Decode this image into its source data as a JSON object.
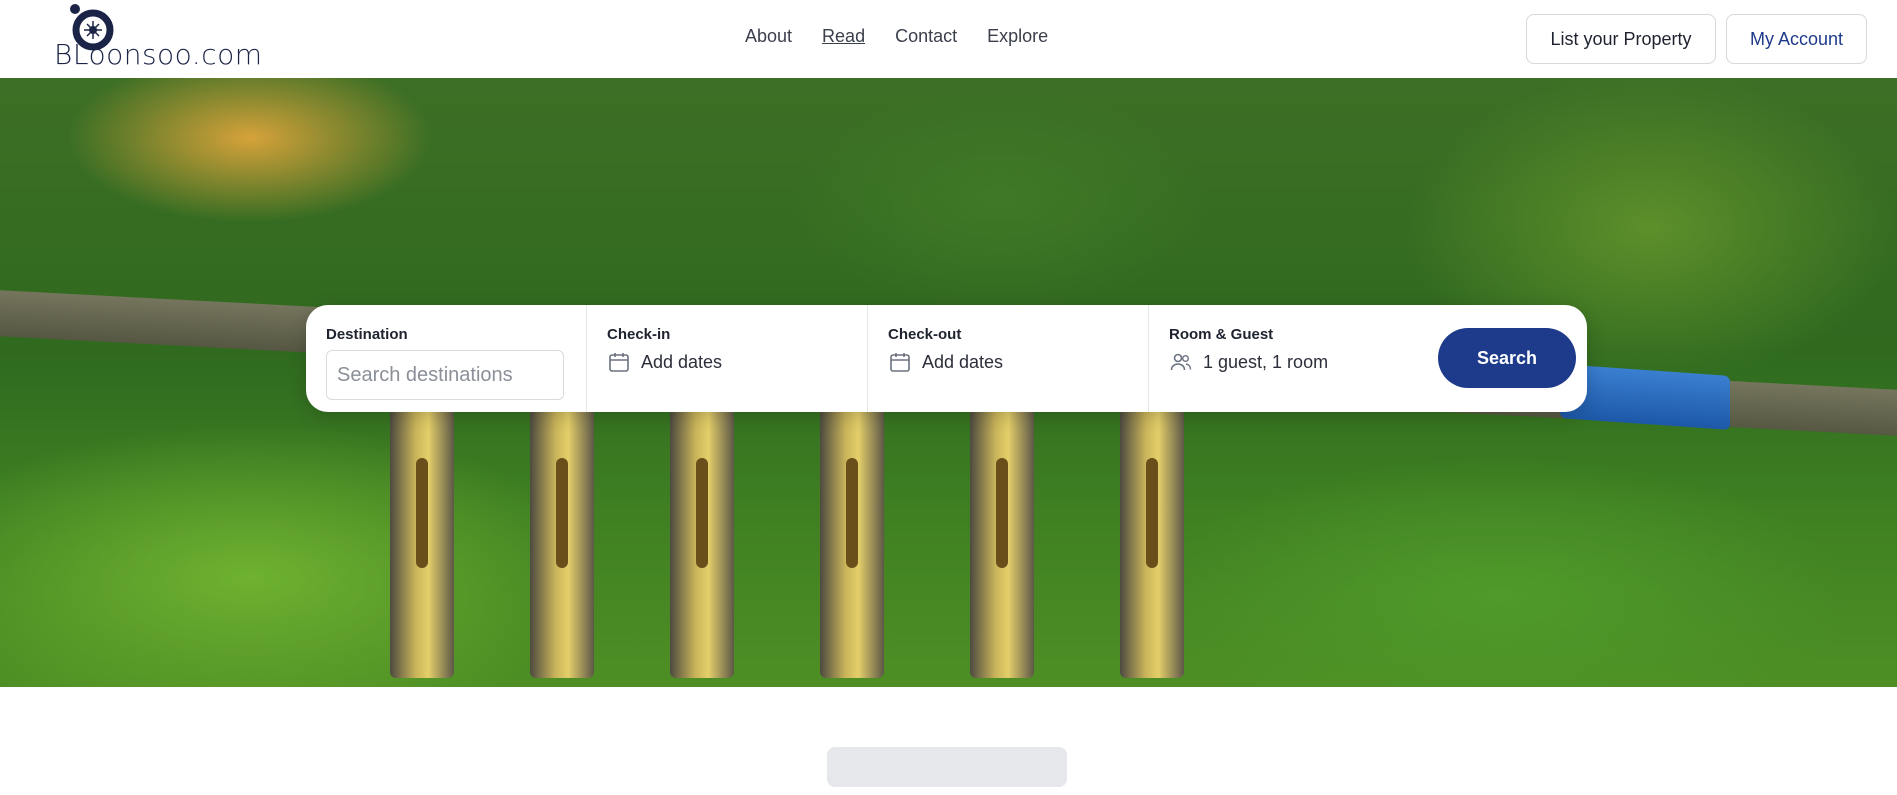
{
  "brand": {
    "name": "BLoonsoo.com"
  },
  "nav": {
    "items": [
      {
        "label": "About"
      },
      {
        "label": "Read"
      },
      {
        "label": "Contact"
      },
      {
        "label": "Explore"
      }
    ]
  },
  "header_buttons": {
    "list_property": "List your Property",
    "my_account": "My Account"
  },
  "search": {
    "destination": {
      "label": "Destination",
      "placeholder": "Search destinations",
      "value": ""
    },
    "checkin": {
      "label": "Check-in",
      "value": "Add dates",
      "icon": "calendar-icon"
    },
    "checkout": {
      "label": "Check-out",
      "value": "Add dates",
      "icon": "calendar-icon"
    },
    "guests": {
      "label": "Room & Guest",
      "value": "1 guest, 1 room",
      "icon": "users-icon"
    },
    "button_label": "Search"
  },
  "colors": {
    "accent": "#1e3a8a",
    "brand_text": "#1b2447"
  }
}
